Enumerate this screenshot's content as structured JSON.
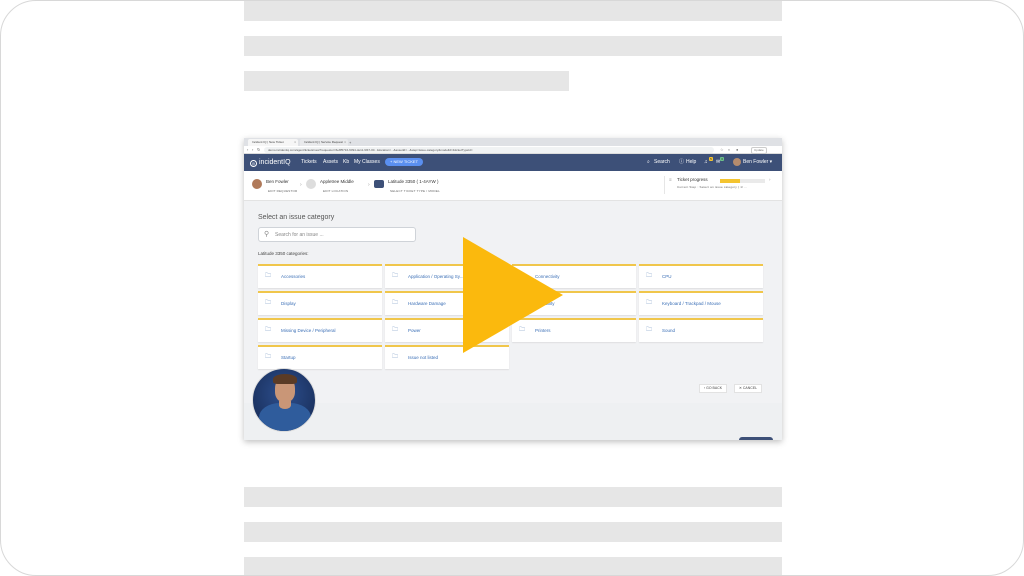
{
  "browser": {
    "tabs": [
      {
        "label": "Incident IQ | New Ticket"
      },
      {
        "label": "Incident IQ | Service Request"
      }
    ],
    "new_tab_symbol": "+",
    "close_symbol": "×",
    "url": "demo.incidentiq.com/agent/tickets/new?requestor=6e8f5716-6094-de11-9f47-00...&location=...&assetId=...&step=issue-category&modelId=&ticketTypeId=",
    "profile_label": "Update"
  },
  "app": {
    "logo_text": "incidentIQ",
    "nav": [
      "Tickets",
      "Assets",
      "Kb",
      "My Classes"
    ],
    "new_ticket_label": "+ NEW TICKET",
    "search_label": "Search",
    "help_label": "Help",
    "badge_one": "5",
    "badge_two": "3",
    "user_name": "Ben Fowler ▾"
  },
  "steps": {
    "requestor": {
      "name": "Ben Fowler",
      "sub": "EDIT REQUESTOR"
    },
    "location": {
      "name": "Appletree Middle",
      "sub": "EDIT LOCATION"
    },
    "asset": {
      "name": "Latitude 3350 ( 1-4AYW )",
      "sub": "SELECT TICKET TYPE / MODEL"
    },
    "progress": {
      "title": "Ticket progress",
      "current": "Current Step : Select an issue category ( 1/ …",
      "fraction": 0.45
    }
  },
  "content": {
    "heading": "Select an issue category",
    "search_placeholder": "Search for an issue ...",
    "categories_label": "Latitude 3350 categories:",
    "categories": [
      {
        "label": "Accessories"
      },
      {
        "label": "Application / Operating Sy..."
      },
      {
        "label": "Connectivity"
      },
      {
        "label": "CPU"
      },
      {
        "label": "Display"
      },
      {
        "label": "Hardware Damage"
      },
      {
        "label": "/ Usability"
      },
      {
        "label": "Keyboard / Trackpad / Mouse"
      },
      {
        "label": "Missing Device / Peripheral"
      },
      {
        "label": "Power"
      },
      {
        "label": "Printers"
      },
      {
        "label": "Sound"
      },
      {
        "label": "Startup"
      },
      {
        "label": "Issue not listed"
      }
    ],
    "back_label": "‹ GO BACK",
    "cancel_label": "✕ CANCEL"
  },
  "colors": {
    "appbar": "#3d5078",
    "accent": "#f0c64b",
    "play": "#fbb90d",
    "link": "#3b6fb6"
  },
  "icons": {
    "category": "folder-icon",
    "search": "search-icon",
    "play": "play-icon"
  }
}
